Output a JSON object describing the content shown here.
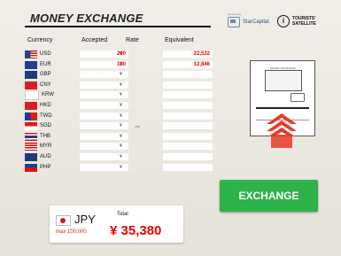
{
  "header": {
    "title": "MONEY EXCHANGE"
  },
  "logos": {
    "partner_small": "powered by",
    "partner": "StarCapital",
    "brand_glyph": "i",
    "brand_line1": "TOURISTS'",
    "brand_line2": "SATELLITE"
  },
  "columns": {
    "currency": "Currency",
    "accepted": "Accepted",
    "rate": "Rate",
    "equivalent": "Equivalent"
  },
  "yen_symbol": "¥",
  "rows": [
    {
      "code": "USD",
      "accepted": "200",
      "equivalent": "22,532"
    },
    {
      "code": "EUR",
      "accepted": "100",
      "equivalent": "12,846"
    },
    {
      "code": "GBP",
      "accepted": "",
      "equivalent": ""
    },
    {
      "code": "CNY",
      "accepted": "",
      "equivalent": ""
    },
    {
      "code": "KRW",
      "accepted": "",
      "equivalent": ""
    },
    {
      "code": "HKD",
      "accepted": "",
      "equivalent": ""
    },
    {
      "code": "TWD",
      "accepted": "",
      "equivalent": ""
    },
    {
      "code": "SGD",
      "accepted": "",
      "equivalent": ""
    },
    {
      "code": "THB",
      "accepted": "",
      "equivalent": ""
    },
    {
      "code": "MYR",
      "accepted": "",
      "equivalent": ""
    },
    {
      "code": "AUD",
      "accepted": "",
      "equivalent": ""
    },
    {
      "code": "PHP",
      "accepted": "",
      "equivalent": ""
    }
  ],
  "machine": {
    "label": "MONEY EXCHANGE"
  },
  "exchange_button": "EXCHANGE",
  "total": {
    "currency": "JPY",
    "label": "Total",
    "max": "max 100,000",
    "amount": "¥ 35,380"
  },
  "colors": {
    "accent_red": "#e00000",
    "exchange_green": "#2db34a",
    "machine_arrow": "#e83a2a"
  }
}
